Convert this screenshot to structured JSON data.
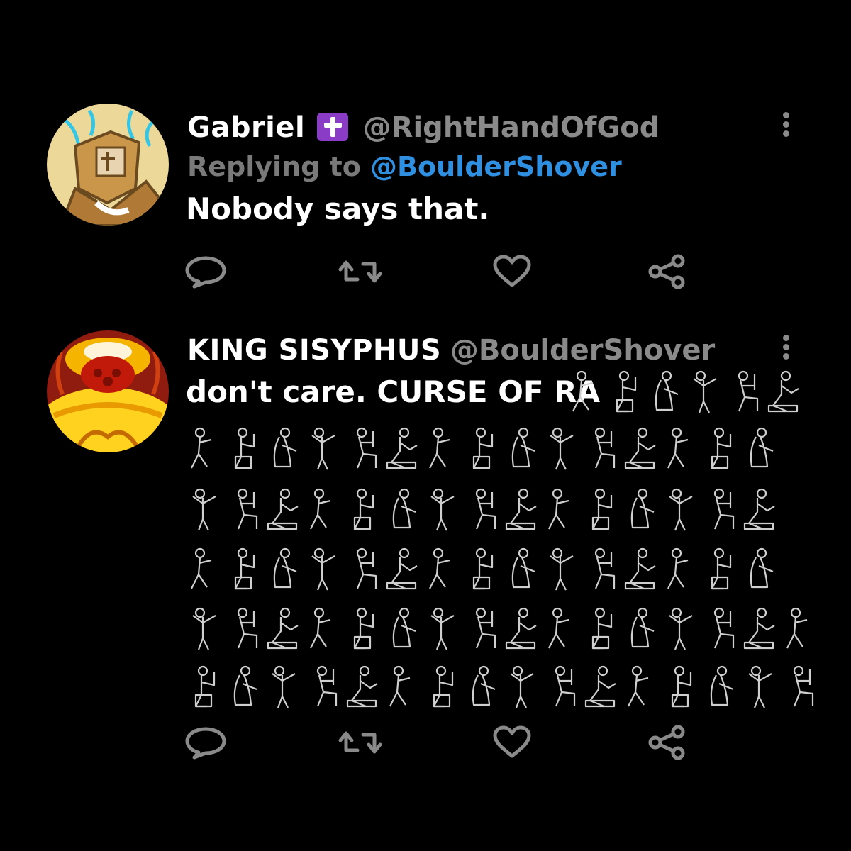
{
  "tweets": [
    {
      "display_name": "Gabriel",
      "badge_icon": "cross-badge-icon",
      "handle": "@RightHandOfGod",
      "reply_prefix": "Replying to",
      "reply_handle": "@BoulderShover",
      "text": "Nobody says that."
    },
    {
      "display_name": "KING SISYPHUS",
      "handle": "@BoulderShover",
      "text": "don't care. CURSE OF RA",
      "hieroglyph_count": 83
    }
  ],
  "actions": [
    "reply-icon",
    "retweet-icon",
    "like-icon",
    "share-icon"
  ],
  "colors": {
    "background": "#000000",
    "muted": "#8a8a8a",
    "link": "#2f8fe0",
    "badge": "#8a3cc7"
  }
}
